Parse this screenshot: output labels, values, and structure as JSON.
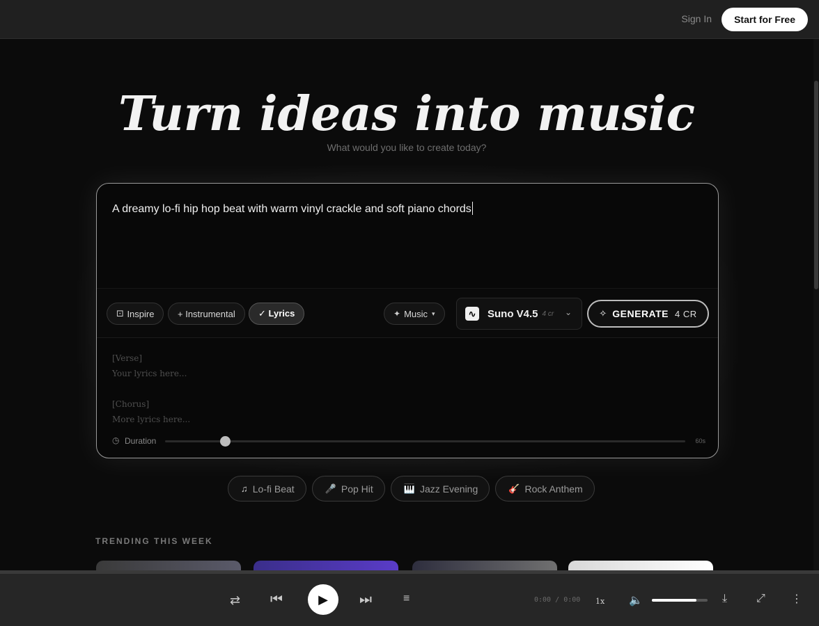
{
  "header": {
    "signin_label": "Sign In",
    "start_label": "Start for Free"
  },
  "hero": {
    "title": "Turn ideas into music",
    "subtitle": "What would you like to create today?"
  },
  "composer": {
    "prompt_value": "A dreamy lo-fi hip hop beat with warm vinyl crackle and soft piano chords",
    "toolbar": {
      "inspire_label": "Inspire",
      "instrumental_label": "+ Instrumental",
      "lyrics_label": "✓ Lyrics",
      "lyrics_active": true,
      "mode_label": "Music",
      "model_name": "Suno V4.5",
      "model_cost": "4 cr",
      "generate_label": "GENERATE",
      "generate_cost": "4 CR"
    },
    "lyrics_placeholder": "[Verse]\nYour lyrics here...\n\n[Chorus]\nMore lyrics here...",
    "duration": {
      "label": "Duration",
      "max_label": "60s",
      "value_fraction": 0.115
    }
  },
  "suggestions": [
    {
      "icon": "music-note-icon",
      "glyph": "♫",
      "label": "Lo-fi Beat"
    },
    {
      "icon": "microphone-icon",
      "glyph": "🎤",
      "label": "Pop Hit"
    },
    {
      "icon": "piano-icon",
      "glyph": "🎹",
      "label": "Jazz Evening"
    },
    {
      "icon": "guitar-icon",
      "glyph": "🎸",
      "label": "Rock Anthem"
    }
  ],
  "trending": {
    "label": "TRENDING THIS WEEK"
  },
  "player": {
    "current_time": "0:00",
    "separator": "/",
    "total_time": "0:00",
    "speed": "1x",
    "volume_fraction": 0.8
  }
}
